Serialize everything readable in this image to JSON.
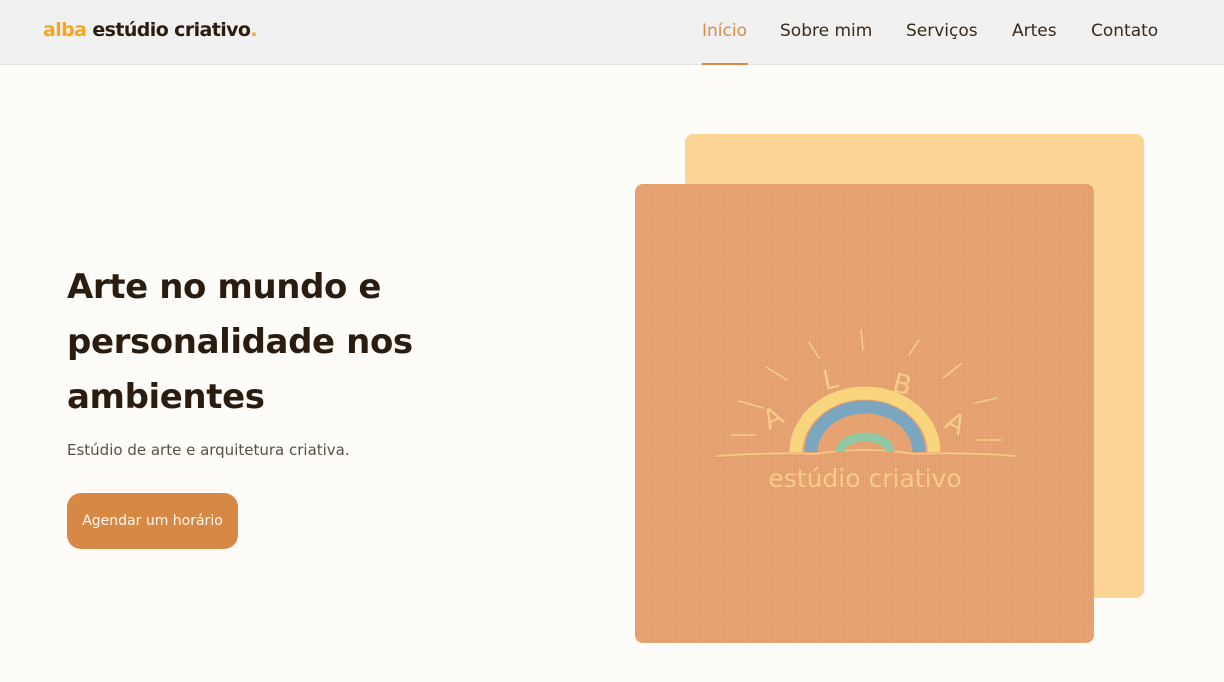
{
  "header": {
    "logo": {
      "accent": "alba",
      "rest": " estúdio criativo",
      "dot": "."
    },
    "nav": [
      {
        "label": "Início",
        "active": true
      },
      {
        "label": "Sobre mim",
        "active": false
      },
      {
        "label": "Serviços",
        "active": false
      },
      {
        "label": "Artes",
        "active": false
      },
      {
        "label": "Contato",
        "active": false
      }
    ]
  },
  "hero": {
    "title": "Arte no mundo e personalidade nos ambientes",
    "subtitle": "Estúdio de arte e arquitetura criativa.",
    "cta_label": "Agendar um horário"
  },
  "brand_image": {
    "letters": [
      "A",
      "L",
      "B",
      "A"
    ],
    "tagline": "estúdio criativo"
  },
  "colors": {
    "accent": "#f5a623",
    "active_nav": "#d98c45",
    "button": "#d88845",
    "card_back": "#fbd496",
    "card_front": "#e8a170",
    "rainbow_outer": "#f9d57e",
    "rainbow_middle": "#7ba6c0",
    "rainbow_inner": "#92c9a5"
  }
}
